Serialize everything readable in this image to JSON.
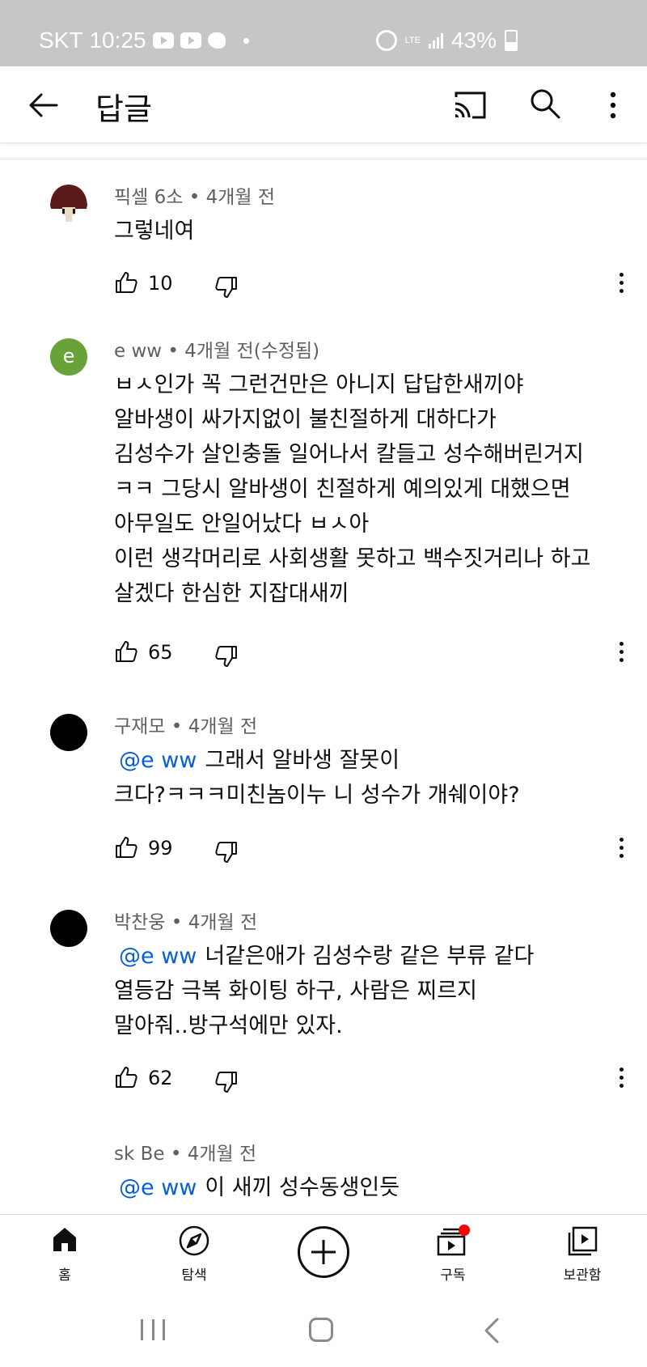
{
  "status_bar": {
    "carrier": "SKT",
    "time": "10:25",
    "network": "LTE",
    "battery": "43%"
  },
  "header": {
    "title": "답글"
  },
  "comments": [
    {
      "author": "픽셀 6소",
      "time": "4개월 전",
      "avatar_color": "#5a1a1a",
      "lines": [
        "그렇네여"
      ],
      "likes": "10"
    },
    {
      "author": "e ww",
      "time": "4개월 전(수정됨)",
      "avatar_letter": "e",
      "avatar_color": "#6aa23a",
      "lines": [
        "ㅂㅅ인가 꼭 그런건만은 아니지 답답한새끼야",
        "알바생이 싸가지없이 불친절하게 대하다가",
        "김성수가 살인충돌 일어나서 칼들고 성수해버린거지",
        "ㅋㅋ 그당시 알바생이 친절하게 예의있게 대했으면",
        "아무일도 안일어났다 ㅂㅅ아",
        "이런 생각머리로 사회생활 못하고 백수짓거리나 하고",
        "살겠다 한심한 지잡대새끼"
      ],
      "likes": "65"
    },
    {
      "author": "구재모",
      "time": "4개월 전",
      "avatar_color": "#000000",
      "mention": "@e ww",
      "lines": [
        "그래서 알바생 잘못이",
        "크다?ㅋㅋㅋ미친놈이누 니 성수가 개쉐이야?"
      ],
      "likes": "99"
    },
    {
      "author": "박찬웅",
      "time": "4개월 전",
      "avatar_color": "#000000",
      "mention": "@e ww",
      "lines": [
        "너같은애가 김성수랑 같은 부류 같다",
        "열등감 극복 화이팅 하구, 사람은 찌르지",
        "말아줘..방구석에만 있자."
      ],
      "likes": "62"
    },
    {
      "author": "sk Be",
      "time": "4개월 전",
      "mention": "@e ww",
      "lines": [
        "이 새끼 성수동생인듯"
      ]
    }
  ],
  "bottom_nav": {
    "home": "홈",
    "explore": "탐색",
    "subscriptions": "구독",
    "library": "보관함"
  },
  "colors": {
    "mention": "#065fd4",
    "status_bar_bg": "#c6c6c6",
    "notification_dot": "#ff0000"
  }
}
